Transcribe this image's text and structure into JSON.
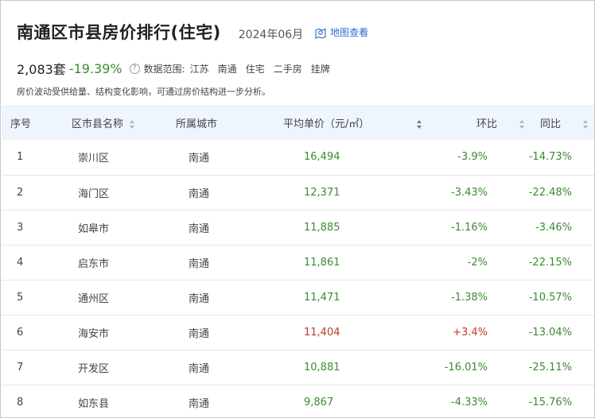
{
  "header": {
    "title": "南通区市县房价排行(住宅)",
    "date": "2024年06月",
    "map_link": "地图查看"
  },
  "stats": {
    "count": "2,083套",
    "change": "-19.39%",
    "help_glyph": "?",
    "scope_label": "数据范围:",
    "scope": [
      "江苏",
      "南通",
      "住宅",
      "二手房",
      "挂牌"
    ]
  },
  "description": "房价波动受供给量、结构变化影响，可通过房价结构进一步分析。",
  "table": {
    "headers": [
      "序号",
      "区市县名称",
      "所属城市",
      "平均单价（元/㎡）",
      "环比",
      "同比"
    ],
    "rows": [
      {
        "idx": "1",
        "name": "崇川区",
        "city": "南通",
        "price": "16,494",
        "mom": "-3.9%",
        "yoy": "-14.73%",
        "up": false
      },
      {
        "idx": "2",
        "name": "海门区",
        "city": "南通",
        "price": "12,371",
        "mom": "-3.43%",
        "yoy": "-22.48%",
        "up": false
      },
      {
        "idx": "3",
        "name": "如皋市",
        "city": "南通",
        "price": "11,885",
        "mom": "-1.16%",
        "yoy": "-3.46%",
        "up": false
      },
      {
        "idx": "4",
        "name": "启东市",
        "city": "南通",
        "price": "11,861",
        "mom": "-2%",
        "yoy": "-22.15%",
        "up": false
      },
      {
        "idx": "5",
        "name": "通州区",
        "city": "南通",
        "price": "11,471",
        "mom": "-1.38%",
        "yoy": "-10.57%",
        "up": false
      },
      {
        "idx": "6",
        "name": "海安市",
        "city": "南通",
        "price": "11,404",
        "mom": "+3.4%",
        "yoy": "-13.04%",
        "up": true
      },
      {
        "idx": "7",
        "name": "开发区",
        "city": "南通",
        "price": "10,881",
        "mom": "-16.01%",
        "yoy": "-25.11%",
        "up": false
      },
      {
        "idx": "8",
        "name": "如东县",
        "city": "南通",
        "price": "9,867",
        "mom": "-4.33%",
        "yoy": "-15.76%",
        "up": false
      }
    ]
  },
  "colors": {
    "down": "#3d8a32",
    "up": "#c0392b",
    "link": "#2a6bd1",
    "header_bg": "#eef5fd"
  }
}
